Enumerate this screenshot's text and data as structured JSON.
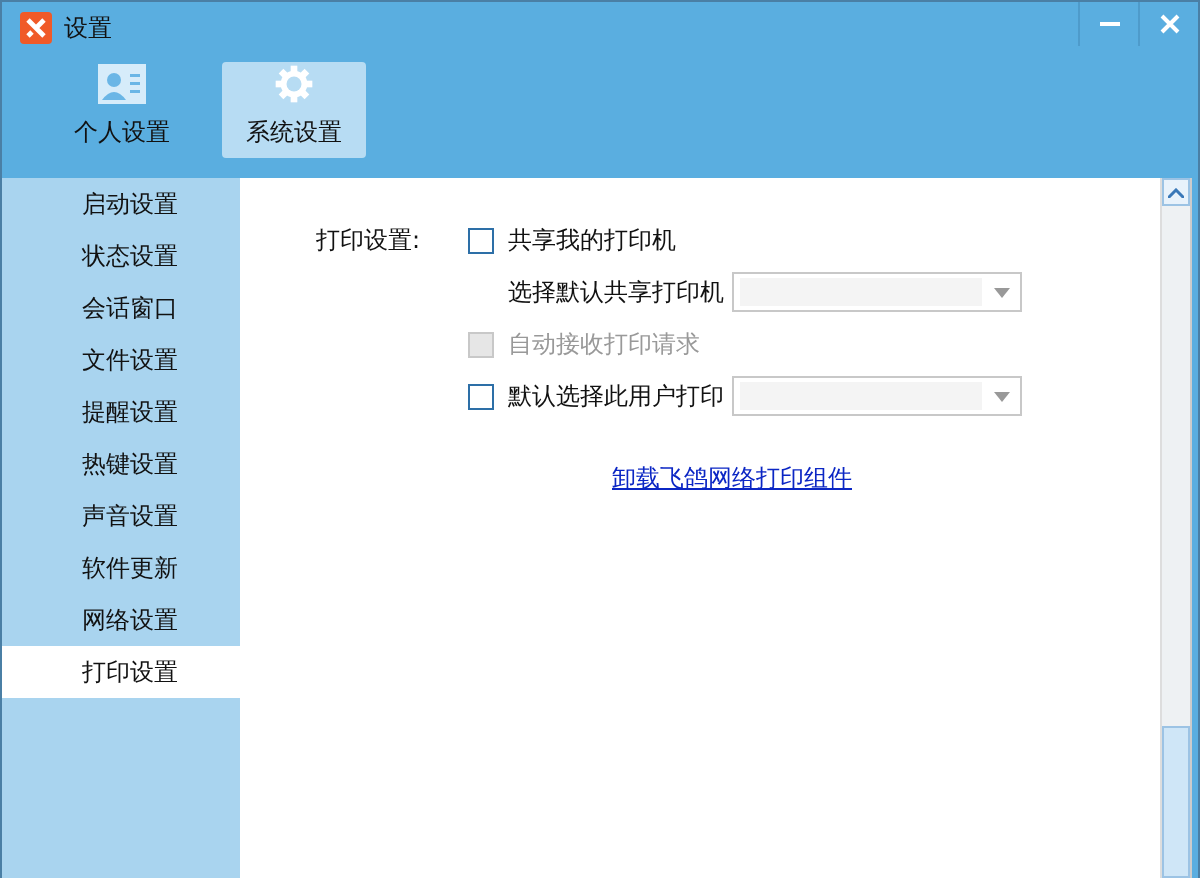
{
  "window": {
    "title": "设置"
  },
  "tabs": [
    {
      "label": "个人设置",
      "kind": "person",
      "selected": false
    },
    {
      "label": "系统设置",
      "kind": "gear",
      "selected": true
    }
  ],
  "sidebar": {
    "items": [
      {
        "label": "启动设置",
        "selected": false
      },
      {
        "label": "状态设置",
        "selected": false
      },
      {
        "label": "会话窗口",
        "selected": false
      },
      {
        "label": "文件设置",
        "selected": false
      },
      {
        "label": "提醒设置",
        "selected": false
      },
      {
        "label": "热键设置",
        "selected": false
      },
      {
        "label": "声音设置",
        "selected": false
      },
      {
        "label": "软件更新",
        "selected": false
      },
      {
        "label": "网络设置",
        "selected": false
      },
      {
        "label": "打印设置",
        "selected": true
      }
    ]
  },
  "print_settings": {
    "label": "打印设置:",
    "rows": [
      {
        "kind": "checkbox",
        "label": "共享我的打印机",
        "checked": false,
        "disabled": false
      },
      {
        "kind": "select",
        "label": "选择默认共享打印机"
      },
      {
        "kind": "checkbox",
        "label": "自动接收打印请求",
        "checked": false,
        "disabled": true
      },
      {
        "kind": "checkbox-select",
        "label": "默认选择此用户打印",
        "checked": false,
        "disabled": false
      }
    ],
    "link": "卸载飞鸽网络打印组件"
  }
}
